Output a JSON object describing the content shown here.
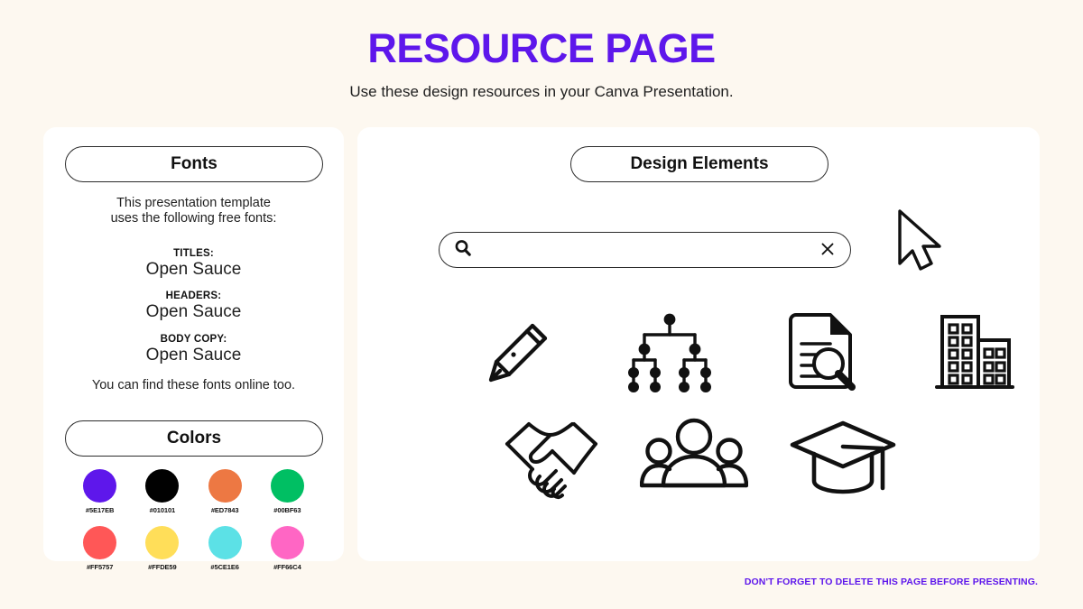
{
  "header": {
    "title": "RESOURCE PAGE",
    "subtitle": "Use these design resources in your Canva Presentation."
  },
  "fonts_panel": {
    "heading": "Fonts",
    "intro_line_1": "This presentation template",
    "intro_line_2": "uses the following free fonts:",
    "groups": [
      {
        "label": "TITLES:",
        "font": "Open Sauce"
      },
      {
        "label": "HEADERS:",
        "font": "Open Sauce"
      },
      {
        "label": "BODY COPY:",
        "font": "Open Sauce"
      }
    ],
    "outro": "You can find these fonts online too."
  },
  "colors_panel": {
    "heading": "Colors",
    "swatches": [
      {
        "hex": "#5E17EB",
        "label": "#5E17EB"
      },
      {
        "hex": "#010101",
        "label": "#010101"
      },
      {
        "hex": "#ED7843",
        "label": "#ED7843"
      },
      {
        "hex": "#00BF63",
        "label": "#00BF63"
      },
      {
        "hex": "#FF5757",
        "label": "#FF5757"
      },
      {
        "hex": "#FFDE59",
        "label": "#FFDE59"
      },
      {
        "hex": "#5CE1E6",
        "label": "#5CE1E6"
      },
      {
        "hex": "#FF66C4",
        "label": "#FF66C4"
      }
    ]
  },
  "design_panel": {
    "heading": "Design Elements",
    "search": {
      "value": "",
      "placeholder": "",
      "search_icon": "search-icon",
      "clear_icon": "close-icon"
    },
    "cursor_icon": "mouse-cursor-icon",
    "icons_row_1": [
      "pencil-icon",
      "org-chart-icon",
      "document-search-icon",
      "office-buildings-icon"
    ],
    "icons_row_2": [
      "handshake-icon",
      "people-group-icon",
      "graduation-cap-icon"
    ]
  },
  "footer": {
    "note": "DON'T FORGET TO DELETE THIS PAGE BEFORE PRESENTING."
  },
  "theme": {
    "background": "#FDF8F0",
    "panel": "#FFFFFF",
    "accent": "#5E17EB",
    "ink": "#1a1a1a"
  }
}
